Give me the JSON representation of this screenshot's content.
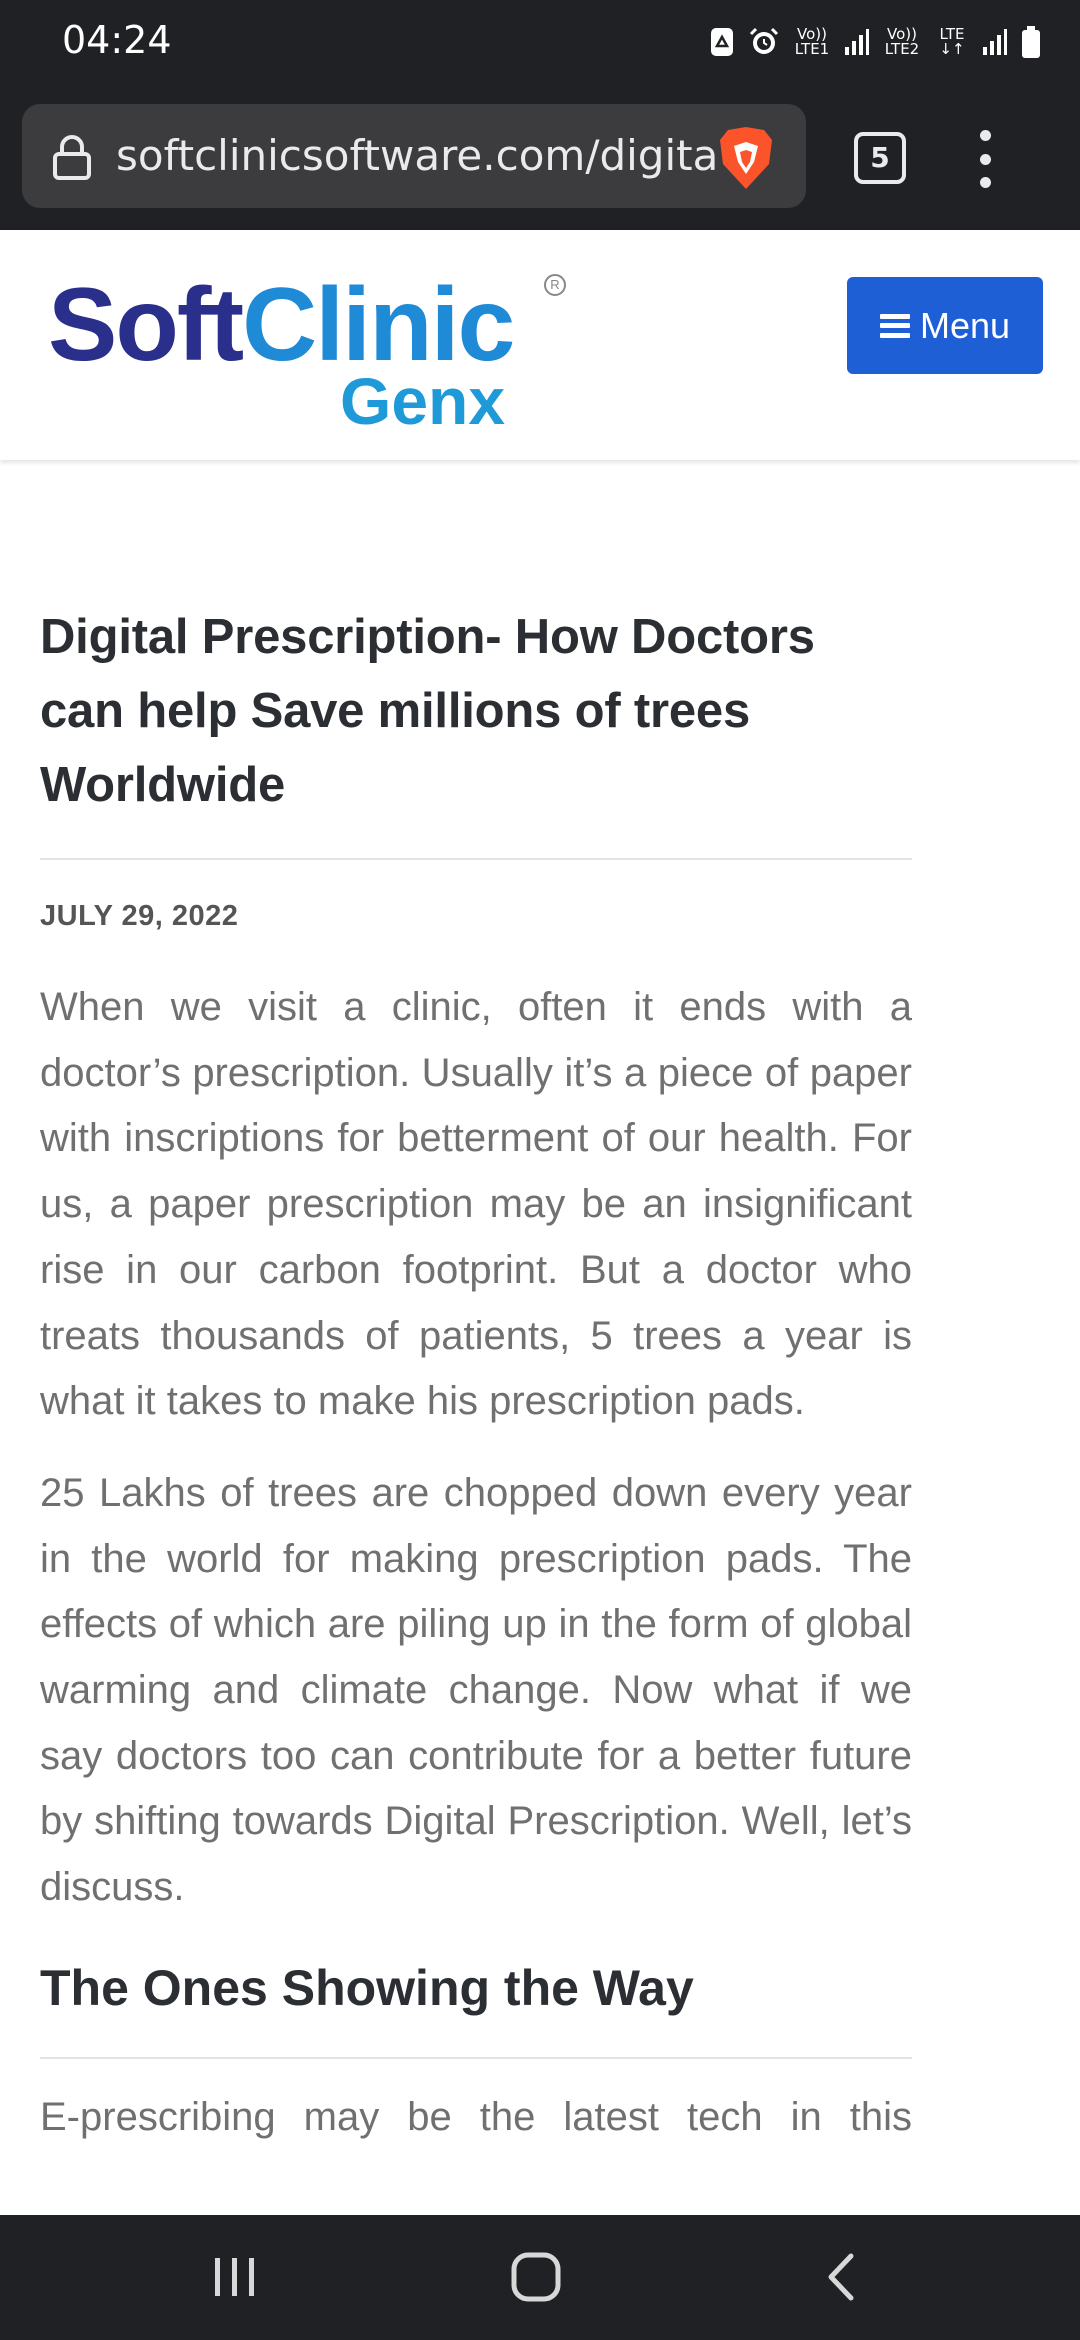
{
  "status_bar": {
    "time": "04:24",
    "sim1_label": "Vo)) LTE1",
    "sim2_label": "Vo)) LTE2",
    "sim2_net": "LTE"
  },
  "browser": {
    "url": "softclinicsoftware.com/digital-prescription",
    "tab_count": "5"
  },
  "site": {
    "logo_soft": "Soft",
    "logo_clinic": "Clinic",
    "logo_sub": "Genx",
    "logo_reg": "R",
    "menu_label": "Menu"
  },
  "article": {
    "title": "Digital Prescription- How Doctors can help Save millions of trees Worldwide",
    "date": "JULY 29, 2022",
    "paragraph_1": "When we visit a clinic, often it ends with a doctor’s prescription. Usually it’s a piece of paper with inscriptions for betterment of our health. For us, a paper prescription may be an insignificant rise in our carbon footprint. But a doctor who treats thousands of patients, 5 trees a year is what it takes to make his prescription pads.",
    "paragraph_2": "25 Lakhs of trees are chopped down every year in the world for making prescription pads. The effects of which are piling up in the form of global warming and climate change. Now what if we say doctors too can contribute for a better future by shifting towards Digital Prescription. Well, let’s discuss.",
    "section_heading": "The Ones Showing the Way",
    "paragraph_3_visible": "E-prescribing may be the latest tech in this"
  },
  "colors": {
    "brand_dark": "#2b2f8c",
    "brand_light": "#1f8ad6",
    "menu_button": "#1e5fd6",
    "brave_orange": "#fb542b"
  }
}
